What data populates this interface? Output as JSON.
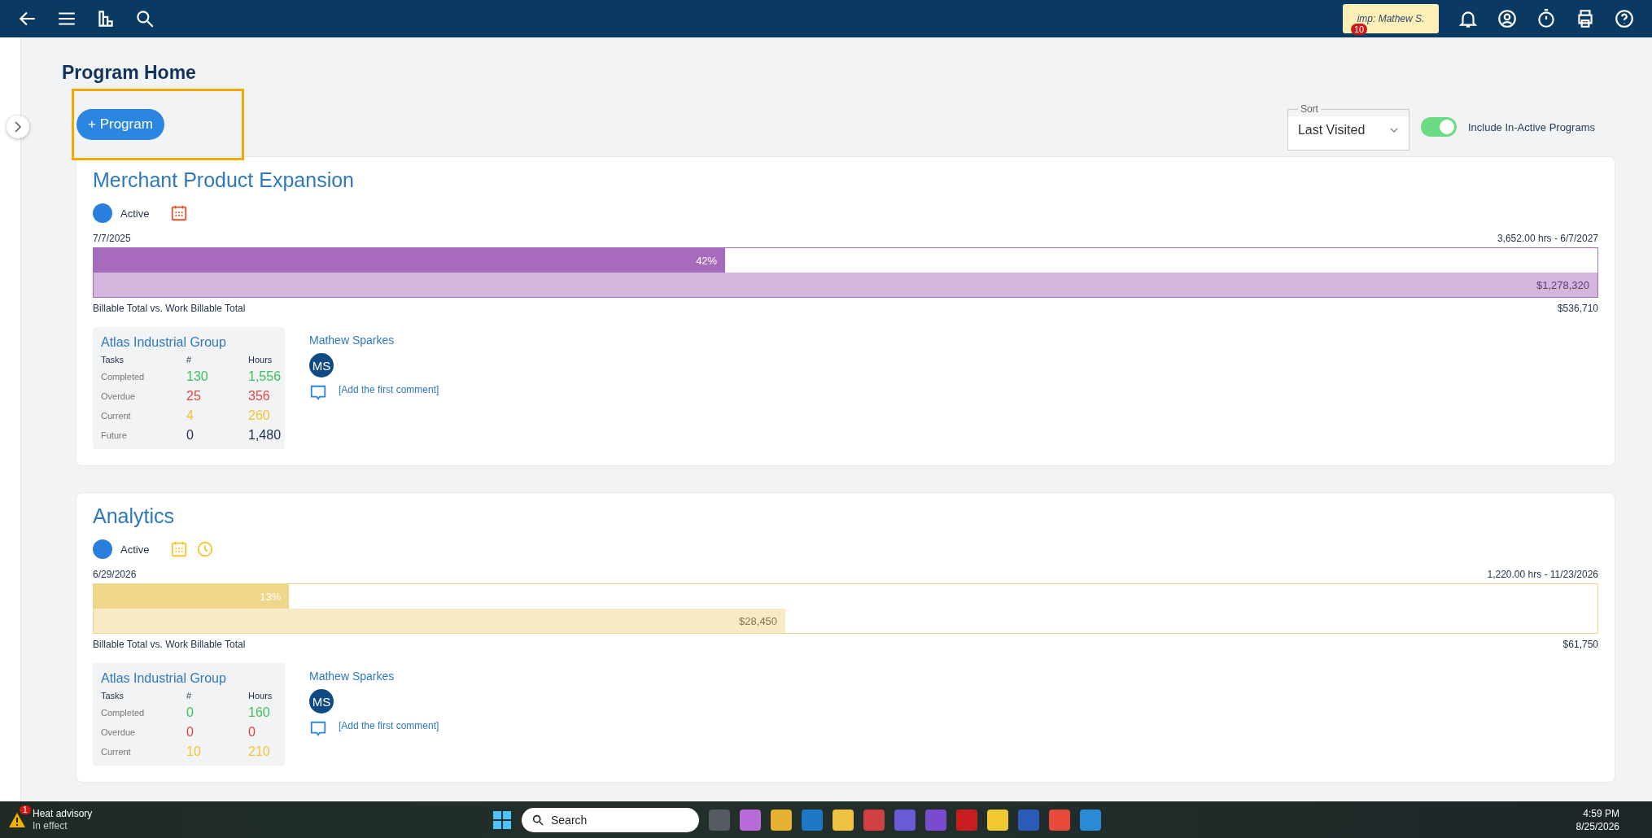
{
  "topbar": {
    "impersonation": {
      "label": "imp: Mathew S.",
      "badge": "10"
    }
  },
  "page": {
    "title": "Program Home",
    "add_button": "+ Program",
    "sort": {
      "label": "Sort",
      "value": "Last Visited"
    },
    "include_inactive": {
      "label": "Include In-Active Programs",
      "on": true
    }
  },
  "programs": [
    {
      "name": "Merchant Product Expansion",
      "status": "Active",
      "color": "#a76bbd",
      "flags": [
        {
          "kind": "calendar",
          "color": "#e0502a"
        }
      ],
      "start_date": "7/7/2025",
      "end_info": "3,652.00 hrs - 6/7/2027",
      "progress": {
        "level": 0.42,
        "label": "42%"
      },
      "billable": {
        "level": 1,
        "label": "$1,278,320"
      },
      "billable_caption": "Billable Total vs. Work Billable Total",
      "work_billable_total": "$536,710",
      "client": "Atlas Industrial Group",
      "stats_headers": [
        "Tasks",
        "#",
        "Hours"
      ],
      "stats": [
        {
          "label": "Completed",
          "count": "130",
          "hours": "1,556",
          "color": "#3cc45a"
        },
        {
          "label": "Overdue",
          "count": "25",
          "hours": "356",
          "color": "#e04646"
        },
        {
          "label": "Current",
          "count": "4",
          "hours": "260",
          "color": "#f5c431"
        },
        {
          "label": "Future",
          "count": "0",
          "hours": "1,480",
          "color": "#1e2f4a"
        }
      ],
      "owner": "Mathew Sparkes",
      "avatar": "MS",
      "comment_link": "[Add the first comment]"
    },
    {
      "name": "Analytics",
      "status": "Active",
      "color": "#eed68a",
      "flags": [
        {
          "kind": "calendar",
          "color": "#f5c431"
        },
        {
          "kind": "clock",
          "color": "#f5c431"
        }
      ],
      "start_date": "6/29/2026",
      "end_info": "1,220.00 hrs - 11/23/2026",
      "progress": {
        "level": 0.13,
        "label": "13%"
      },
      "billable": {
        "level": 0.46,
        "label": "$28,450"
      },
      "billable_caption": "Billable Total vs. Work Billable Total",
      "work_billable_total": "$61,750",
      "client": "Atlas Industrial Group",
      "stats_headers": [
        "Tasks",
        "#",
        "Hours"
      ],
      "stats": [
        {
          "label": "Completed",
          "count": "0",
          "hours": "160",
          "color": "#3cc45a"
        },
        {
          "label": "Overdue",
          "count": "0",
          "hours": "0",
          "color": "#e04646"
        },
        {
          "label": "Current",
          "count": "10",
          "hours": "210",
          "color": "#f5c431"
        }
      ],
      "owner": "Mathew Sparkes",
      "avatar": "MS",
      "comment_link": "[Add the first comment]"
    }
  ],
  "taskbar": {
    "weather": {
      "badge": "1",
      "title": "Heat advisory",
      "subtitle": "In effect"
    },
    "search": {
      "placeholder": "Search"
    },
    "clock": {
      "time": "4:59 PM",
      "date": "8/25/2026"
    }
  }
}
